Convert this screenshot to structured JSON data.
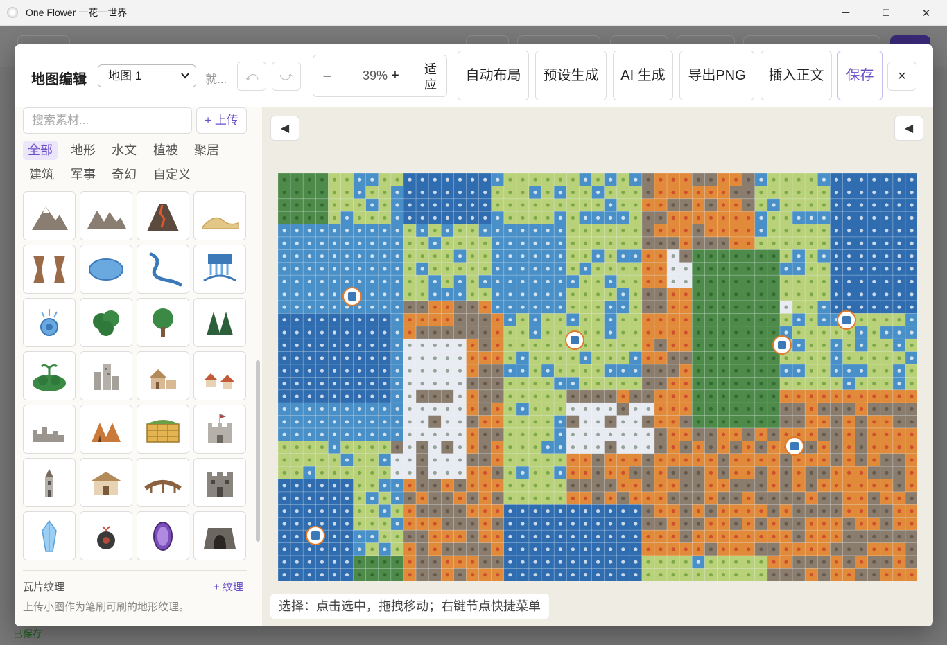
{
  "window": {
    "title": "One Flower 一花一世界",
    "controls": {
      "minimize": "─",
      "maximize": "☐",
      "close": "✕"
    }
  },
  "background": {
    "status": "已保存"
  },
  "toolbar": {
    "title": "地图编辑",
    "map_select": {
      "value": "地图 1"
    },
    "status": "就...",
    "undo": "⤺",
    "redo": "⤻",
    "zoom": {
      "minus": "–",
      "value": "39%",
      "plus": "+",
      "fit": "适应"
    },
    "buttons": {
      "auto_layout": "自动布局",
      "preset": "预设生成",
      "ai": "AI 生成",
      "export": "导出PNG",
      "insert": "插入正文",
      "save": "保存",
      "close": "×"
    }
  },
  "left_panel": {
    "search_placeholder": "搜索素材...",
    "upload": "+ 上传",
    "categories": [
      "全部",
      "地形",
      "水文",
      "植被",
      "聚居",
      "建筑",
      "军事",
      "奇幻",
      "自定义"
    ],
    "active_category": "全部",
    "assets": [
      "mountain-icon",
      "mountain-range-icon",
      "volcano-icon",
      "dune-icon",
      "canyon-icon",
      "lake-icon",
      "river-icon",
      "waterfall-icon",
      "spring-icon",
      "forest-icon",
      "tree-icon",
      "pine-forest-icon",
      "island-icon",
      "city-icon",
      "village-icon",
      "hamlet-icon",
      "ruins-icon",
      "camp-icon",
      "farmland-icon",
      "castle-icon",
      "tower-icon",
      "temple-icon",
      "bridge-icon",
      "fortress-icon",
      "crystal-icon",
      "bomb-icon",
      "portal-icon",
      "cave-icon"
    ],
    "textures": {
      "title": "瓦片纹理",
      "add": "+ 纹理",
      "description": "上传小图作为笔刷可刷的地形纹理。"
    }
  },
  "canvas": {
    "collapse_left": "◀",
    "collapse_right": "◀",
    "hint": "选择：点击选中，拖拽移动；右键节点快捷菜单"
  },
  "map": {
    "name": "地图 1",
    "markers": [
      "port-icon",
      "city-icon",
      "city-icon",
      "city-icon",
      "city-icon",
      "fish-icon"
    ]
  },
  "colors": {
    "accent": "#6a4fc8",
    "deep_water": "#2f6db0",
    "water": "#4a90c8",
    "grassland": "#b9d27a",
    "forest": "#4e8a4a",
    "hills": "#e08a3a",
    "mountain": "#8a7d6e",
    "snow": "#e8ecf2"
  }
}
